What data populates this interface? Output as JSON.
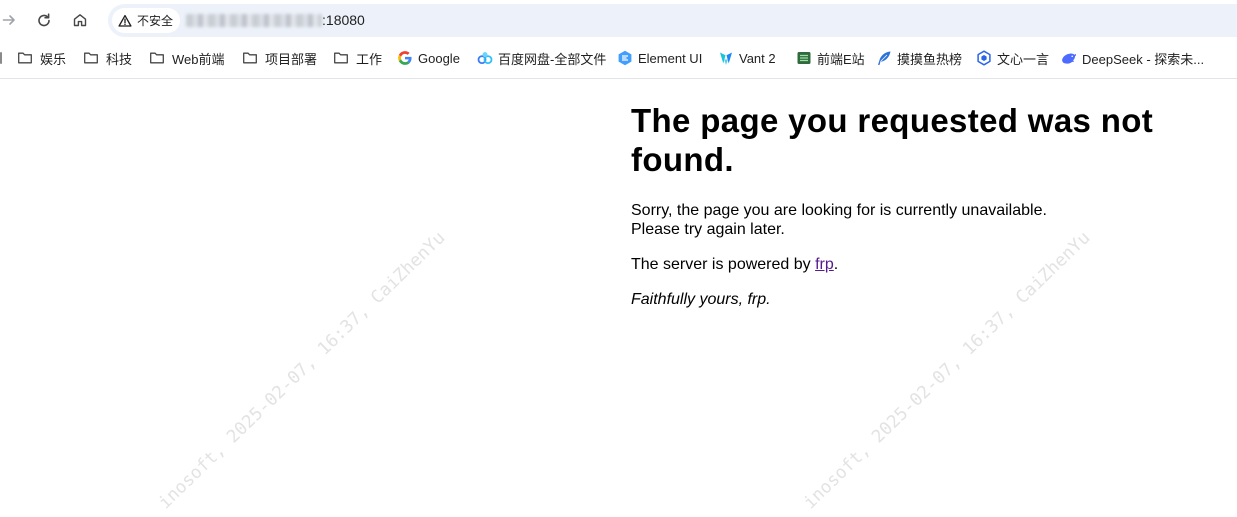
{
  "browser": {
    "toolbar": {
      "forward_icon": "arrow-forward-icon",
      "reload_icon": "reload-icon",
      "home_icon": "home-icon"
    },
    "address_bar": {
      "security_icon": "warning-triangle-icon",
      "security_label": "不安全",
      "url_port": ":18080",
      "background": "#edf2fa"
    },
    "bookmarks": {
      "items": [
        {
          "label": "娱乐",
          "icon": "folder-icon"
        },
        {
          "label": "科技",
          "icon": "folder-icon"
        },
        {
          "label": "Web前端",
          "icon": "folder-icon"
        },
        {
          "label": "项目部署",
          "icon": "folder-icon"
        },
        {
          "label": "工作",
          "icon": "folder-icon"
        },
        {
          "label": "Google",
          "icon": "google-icon"
        },
        {
          "label": "百度网盘-全部文件",
          "icon": "baidu-netdisk-icon"
        },
        {
          "label": "Element UI",
          "icon": "element-ui-icon"
        },
        {
          "label": "Vant 2",
          "icon": "vant-icon"
        },
        {
          "label": "前端E站",
          "icon": "frontend-e-station-icon"
        },
        {
          "label": "摸摸鱼热榜",
          "icon": "momoyu-icon"
        },
        {
          "label": "文心一言",
          "icon": "wenxin-yiyan-icon"
        },
        {
          "label": "DeepSeek - 探索未...",
          "icon": "deepseek-icon"
        }
      ]
    }
  },
  "page": {
    "heading": "The page you requested was not found.",
    "message_line1": "Sorry, the page you are looking for is currently unavailable.",
    "message_line2": "Please try again later.",
    "powered_prefix": "The server is powered by ",
    "powered_link": "frp",
    "powered_suffix": ".",
    "signature": "Faithfully yours, frp."
  },
  "watermark": {
    "text": "inosoft, 2025-02-07, 16:37, CaiZhenYu"
  },
  "colors": {
    "link_visited": "#551a8b",
    "page_text": "#000000",
    "watermark": "#e3e3e3"
  }
}
